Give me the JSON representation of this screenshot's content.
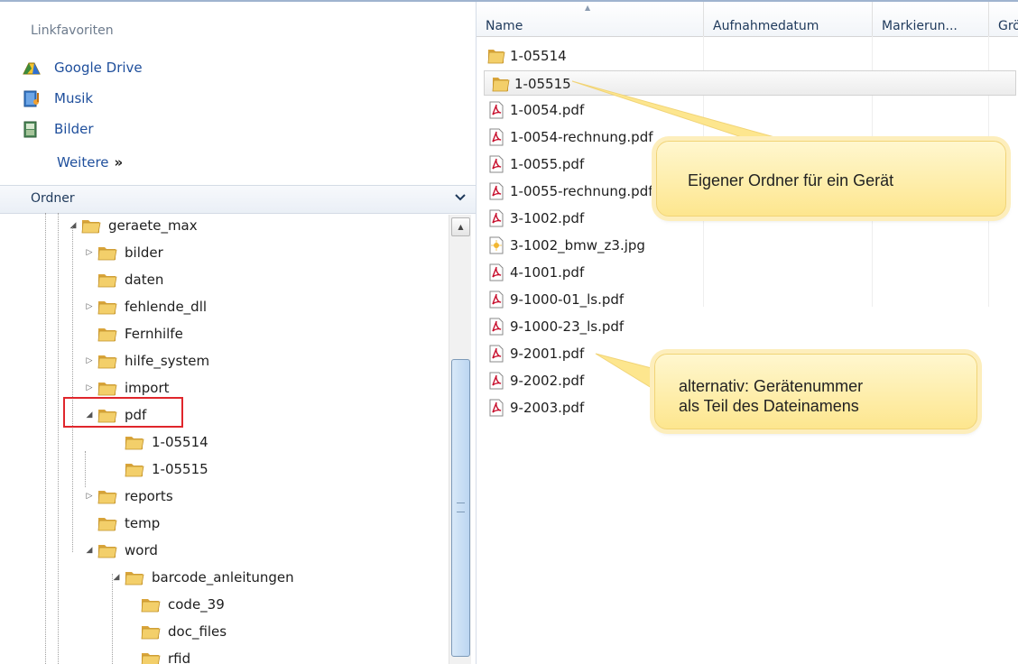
{
  "sidebar": {
    "favorites_header": "Linkfavoriten",
    "favorites": [
      {
        "label": "Google Drive",
        "icon": "google-drive-icon"
      },
      {
        "label": "Musik",
        "icon": "music-library-icon"
      },
      {
        "label": "Bilder",
        "icon": "pictures-library-icon"
      }
    ],
    "more_label": "Weitere",
    "more_chevron": "»",
    "folders_header": "Ordner",
    "folders_chevron": "⌄"
  },
  "tree": [
    {
      "label": "geraete_max",
      "expander": "expanded"
    },
    {
      "label": "bilder",
      "expander": "collapsed"
    },
    {
      "label": "daten",
      "expander": "none"
    },
    {
      "label": "fehlende_dll",
      "expander": "collapsed"
    },
    {
      "label": "Fernhilfe",
      "expander": "none"
    },
    {
      "label": "hilfe_system",
      "expander": "collapsed"
    },
    {
      "label": "import",
      "expander": "collapsed"
    },
    {
      "label": "pdf",
      "expander": "expanded",
      "highlighted": true
    },
    {
      "label": "1-05514",
      "expander": "none"
    },
    {
      "label": "1-05515",
      "expander": "none"
    },
    {
      "label": "reports",
      "expander": "collapsed"
    },
    {
      "label": "temp",
      "expander": "none"
    },
    {
      "label": "word",
      "expander": "expanded"
    },
    {
      "label": "barcode_anleitungen",
      "expander": "expanded"
    },
    {
      "label": "code_39",
      "expander": "none"
    },
    {
      "label": "doc_files",
      "expander": "none"
    },
    {
      "label": "rfid",
      "expander": "none"
    }
  ],
  "columns": [
    "Name",
    "Aufnahmedatum",
    "Markierun...",
    "Grö"
  ],
  "files": [
    {
      "name": "1-05514",
      "type": "folder"
    },
    {
      "name": "1-05515",
      "type": "folder",
      "selected": true
    },
    {
      "name": "1-0054.pdf",
      "type": "pdf"
    },
    {
      "name": "1-0054-rechnung.pdf",
      "type": "pdf"
    },
    {
      "name": "1-0055.pdf",
      "type": "pdf"
    },
    {
      "name": "1-0055-rechnung.pdf",
      "type": "pdf"
    },
    {
      "name": "3-1002.pdf",
      "type": "pdf"
    },
    {
      "name": "3-1002_bmw_z3.jpg",
      "type": "jpg"
    },
    {
      "name": "4-1001.pdf",
      "type": "pdf"
    },
    {
      "name": "9-1000-01_ls.pdf",
      "type": "pdf"
    },
    {
      "name": "9-1000-23_ls.pdf",
      "type": "pdf"
    },
    {
      "name": "9-2001.pdf",
      "type": "pdf"
    },
    {
      "name": "9-2002.pdf",
      "type": "pdf"
    },
    {
      "name": "9-2003.pdf",
      "type": "pdf"
    }
  ],
  "callouts": {
    "device_folder": "Eigener Ordner für ein Gerät",
    "filename_number": "alternativ: Gerätenummer\nals Teil des Dateinamens"
  },
  "colors": {
    "link": "#1f4f9c",
    "highlight_box": "#e0262c",
    "callout_fill": "#fde68e",
    "folder": "#e8b84a",
    "pdf": "#c8102e"
  }
}
